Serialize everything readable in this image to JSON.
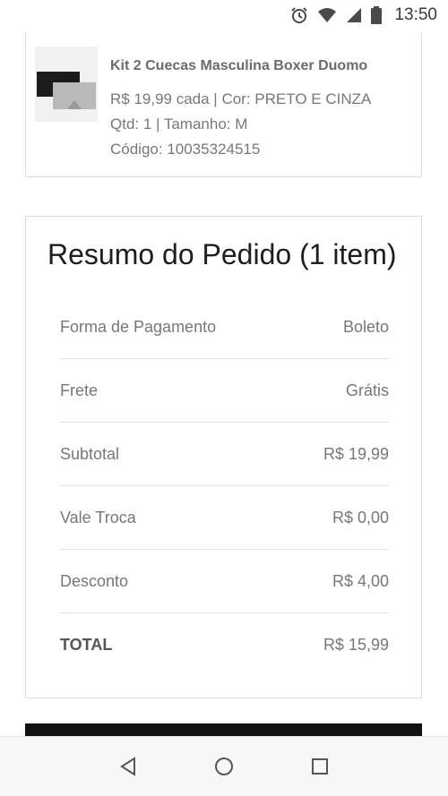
{
  "status": {
    "time": "13:50",
    "icons": [
      "alarm-icon",
      "wifi-icon",
      "signal-icon",
      "battery-icon"
    ]
  },
  "product": {
    "name": "Kit 2 Cuecas Masculina Boxer Duomo",
    "price_line": "R$ 19,99 cada | Cor: PRETO E CINZA",
    "qty_line": "Qtd: 1 | Tamanho: M",
    "code_line": "Código: 10035324515"
  },
  "summary": {
    "title": "Resumo do Pedido (1 item)",
    "rows": [
      {
        "label": "Forma de Pagamento",
        "value": "Boleto"
      },
      {
        "label": "Frete",
        "value": "Grátis"
      },
      {
        "label": "Subtotal",
        "value": "R$ 19,99"
      },
      {
        "label": "Vale Troca",
        "value": "R$ 0,00"
      },
      {
        "label": "Desconto",
        "value": "R$ 4,00"
      },
      {
        "label": "TOTAL",
        "value": "R$ 15,99"
      }
    ]
  },
  "nav": {
    "icons": [
      "back-icon",
      "home-icon",
      "recents-icon"
    ]
  }
}
